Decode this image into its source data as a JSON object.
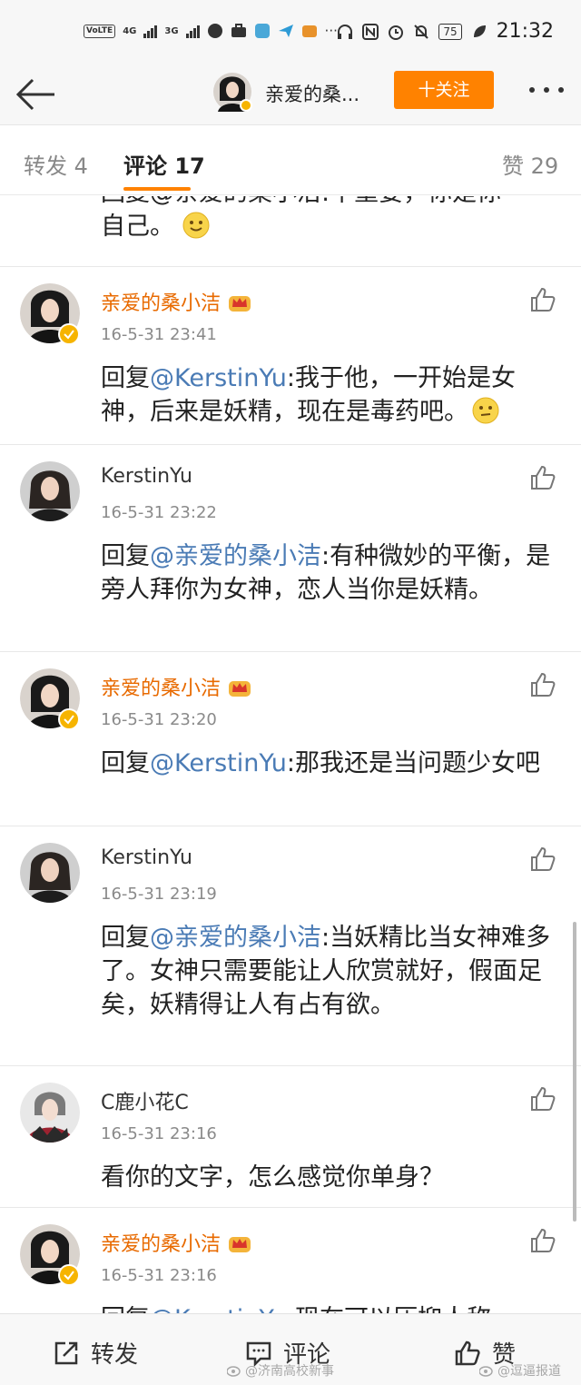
{
  "status_bar": {
    "volte": "VoLTE",
    "net1": "4G",
    "net2": "3G",
    "battery": "75",
    "time": "21:32",
    "more": "···"
  },
  "nav": {
    "title": "亲爱的桑...",
    "follow": "十关注"
  },
  "tabs": {
    "repost": "转发 4",
    "comment": "评论 17",
    "likes": "赞 29"
  },
  "comments": [
    {
      "text_mention": "",
      "text_before": "回复@亲爱的桑小洁:不重要，你是你",
      "text_after": "自己。"
    },
    {
      "name": "亲爱的桑小洁",
      "time": "16-5-31 23:41",
      "prefix": "回复",
      "mention": "@KerstinYu",
      "body": ":我于他，一开始是女神，后来是妖精，现在是毒药吧。"
    },
    {
      "name": "KerstinYu",
      "time": "16-5-31 23:22",
      "prefix": "回复",
      "mention": "@亲爱的桑小洁",
      "body": ":有种微妙的平衡，是旁人拜你为女神，恋人当你是妖精。"
    },
    {
      "name": "亲爱的桑小洁",
      "time": "16-5-31 23:20",
      "prefix": "回复",
      "mention": "@KerstinYu",
      "body": ":那我还是当问题少女吧"
    },
    {
      "name": "KerstinYu",
      "time": "16-5-31 23:19",
      "prefix": "回复",
      "mention": "@亲爱的桑小洁",
      "body": ":当妖精比当女神难多了。女神只需要能让人欣赏就好，假面足矣，妖精得让人有占有欲。"
    },
    {
      "name": "C鹿小花C",
      "time": "16-5-31 23:16",
      "prefix": "",
      "mention": "",
      "body": "看你的文字，怎么感觉你单身？"
    },
    {
      "name": "亲爱的桑小洁",
      "time": "16-5-31 23:16",
      "prefix": "回复",
      "mention": "@KerstinYu",
      "body": ":现在可以压抑人称"
    }
  ],
  "bottom_bar": {
    "repost": "转发",
    "comment": "评论",
    "like": "赞",
    "watermark_left": "@济南高校新事",
    "watermark_right": "@逗逼报道"
  },
  "colors": {
    "accent": "#ff8200",
    "name_orange": "#e86a00",
    "mention_blue": "#4a7bb5"
  },
  "icons": [
    "back-arrow-icon",
    "more-dots-icon",
    "like-thumb-icon",
    "crown-icon",
    "verified-icon",
    "repost-icon",
    "comment-icon",
    "smile-emoji-icon",
    "thinking-emoji-icon"
  ]
}
